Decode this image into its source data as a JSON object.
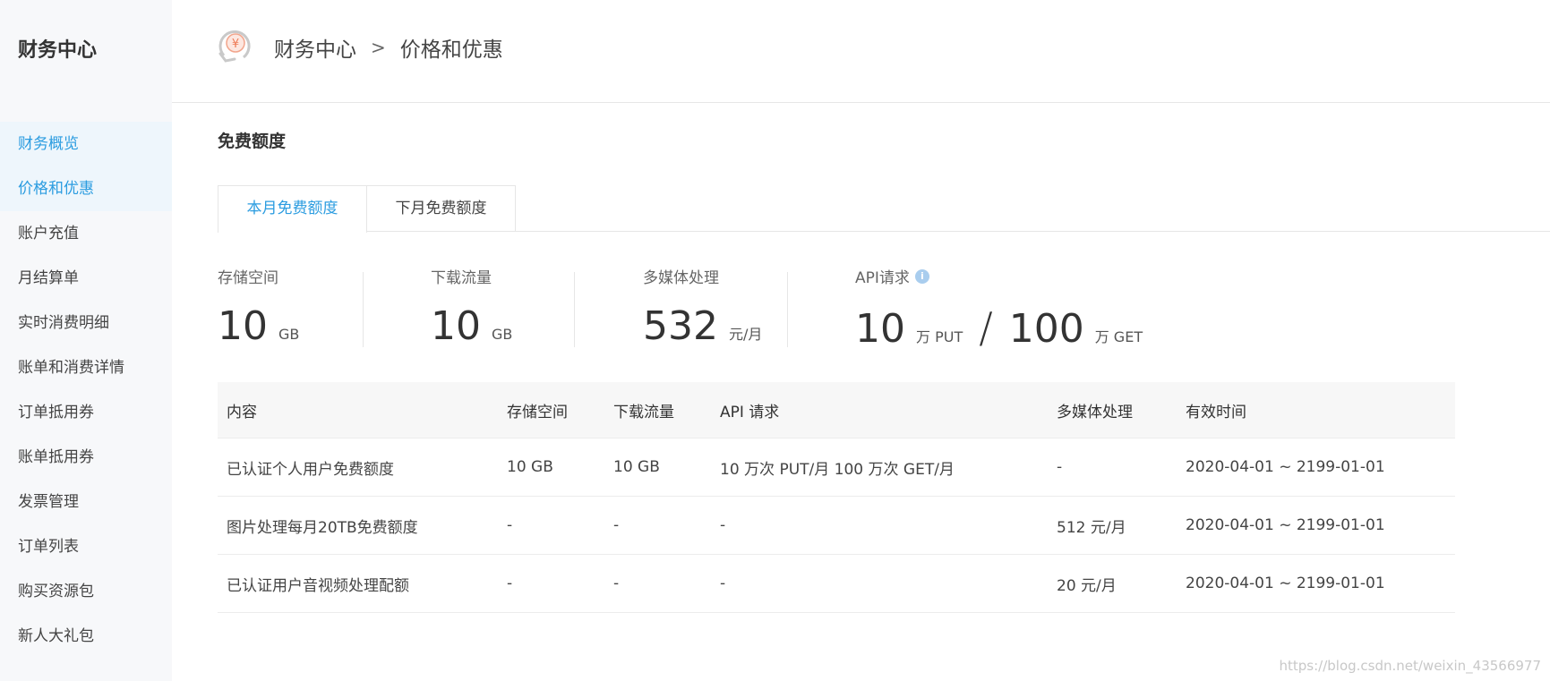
{
  "sidebar": {
    "title": "财务中心",
    "items": [
      {
        "label": "财务概览",
        "state": "highlight"
      },
      {
        "label": "价格和优惠",
        "state": "active"
      },
      {
        "label": "账户充值"
      },
      {
        "label": "月结算单"
      },
      {
        "label": "实时消费明细"
      },
      {
        "label": "账单和消费详情"
      },
      {
        "label": "订单抵用券"
      },
      {
        "label": "账单抵用券"
      },
      {
        "label": "发票管理"
      },
      {
        "label": "订单列表"
      },
      {
        "label": "购买资源包"
      },
      {
        "label": "新人大礼包"
      }
    ]
  },
  "header": {
    "logo_icon": "yuan-coin-icon",
    "breadcrumb": [
      "财务中心",
      "价格和优惠"
    ],
    "separator": ">"
  },
  "section": {
    "title": "免费额度"
  },
  "tabs": [
    {
      "label": "本月免费额度",
      "active": true
    },
    {
      "label": "下月免费额度",
      "active": false
    }
  ],
  "stats": {
    "storage": {
      "label": "存储空间",
      "value": "10",
      "unit": "GB"
    },
    "download": {
      "label": "下载流量",
      "value": "10",
      "unit": "GB"
    },
    "media": {
      "label": "多媒体处理",
      "value": "532",
      "unit": "元/月"
    },
    "api": {
      "label": "API请求",
      "info_icon": "i",
      "put_value": "10",
      "put_unit": "万 PUT",
      "slash": "/",
      "get_value": "100",
      "get_unit": "万 GET"
    }
  },
  "table": {
    "headers": [
      "内容",
      "存储空间",
      "下载流量",
      "API 请求",
      "多媒体处理",
      "有效时间"
    ],
    "rows": [
      [
        "已认证个人用户免费额度",
        "10 GB",
        "10 GB",
        "10 万次 PUT/月 100 万次 GET/月",
        "-",
        "2020-04-01 ~ 2199-01-01"
      ],
      [
        "图片处理每月20TB免费额度",
        "-",
        "-",
        "-",
        "512 元/月",
        "2020-04-01 ~ 2199-01-01"
      ],
      [
        "已认证用户音视频处理配额",
        "-",
        "-",
        "-",
        "20 元/月",
        "2020-04-01 ~ 2199-01-01"
      ]
    ]
  },
  "watermark": "https://blog.csdn.net/weixin_43566977",
  "colors": {
    "accent": "#2b9ce0",
    "sidebar_bg": "#f7f8fa",
    "table_header_bg": "#f7f7f7"
  }
}
